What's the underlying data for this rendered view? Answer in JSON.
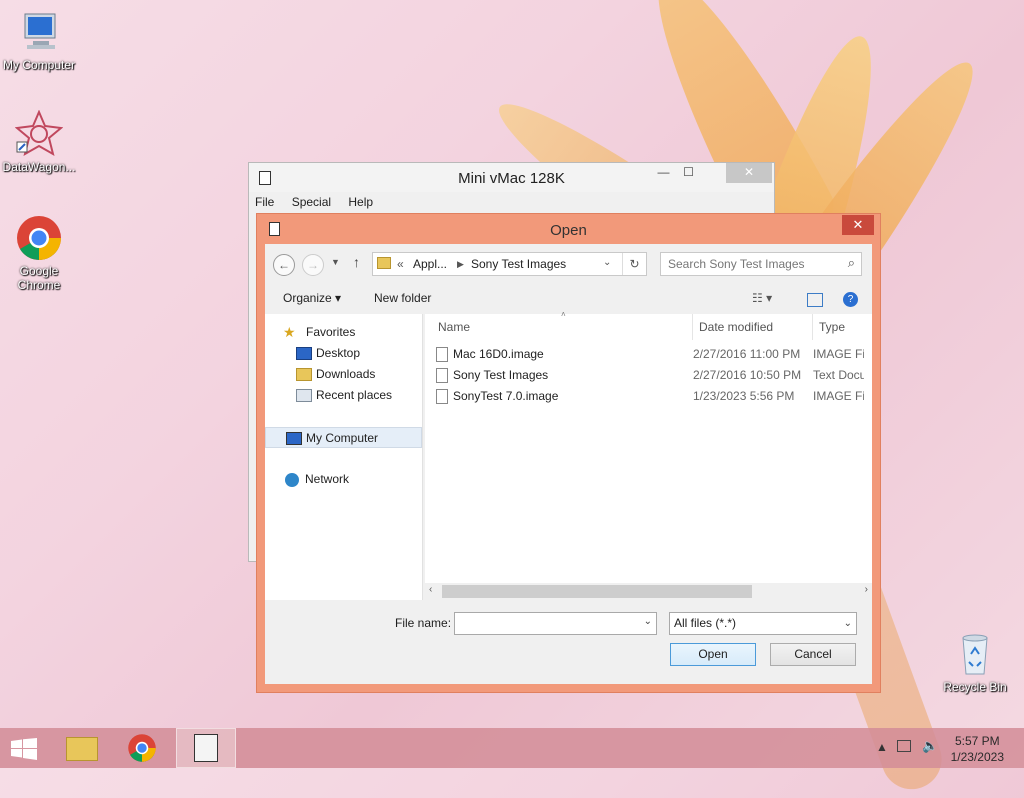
{
  "desktop": {
    "icons": [
      {
        "label": "My Computer"
      },
      {
        "label": "DataWagon..."
      },
      {
        "label": "Google Chrome"
      },
      {
        "label": "Recycle Bin"
      }
    ]
  },
  "vmac_window": {
    "title": "Mini vMac 128K",
    "menu": [
      "File",
      "Special",
      "Help"
    ]
  },
  "open_dialog": {
    "title": "Open",
    "breadcrumb": {
      "prefix": "«",
      "parent": "Appl...",
      "current": "Sony Test Images"
    },
    "search_placeholder": "Search Sony Test Images",
    "toolbar": {
      "organize": "Organize",
      "new_folder": "New folder"
    },
    "nav": {
      "favorites": "Favorites",
      "desktop": "Desktop",
      "downloads": "Downloads",
      "recent": "Recent places",
      "computer": "My Computer",
      "network": "Network"
    },
    "columns": {
      "name": "Name",
      "date": "Date modified",
      "type": "Type"
    },
    "files": [
      {
        "name": "Mac 16D0.image",
        "date": "2/27/2016 11:00 PM",
        "type": "IMAGE File"
      },
      {
        "name": "Sony Test Images",
        "date": "2/27/2016 10:50 PM",
        "type": "Text Document"
      },
      {
        "name": "SonyTest 7.0.image",
        "date": "1/23/2023 5:56 PM",
        "type": "IMAGE File"
      }
    ],
    "file_name_label": "File name:",
    "file_name_value": "",
    "filter": "All files (*.*)",
    "open_label": "Open",
    "cancel_label": "Cancel"
  },
  "taskbar": {
    "time": "5:57 PM",
    "date": "1/23/2023"
  }
}
